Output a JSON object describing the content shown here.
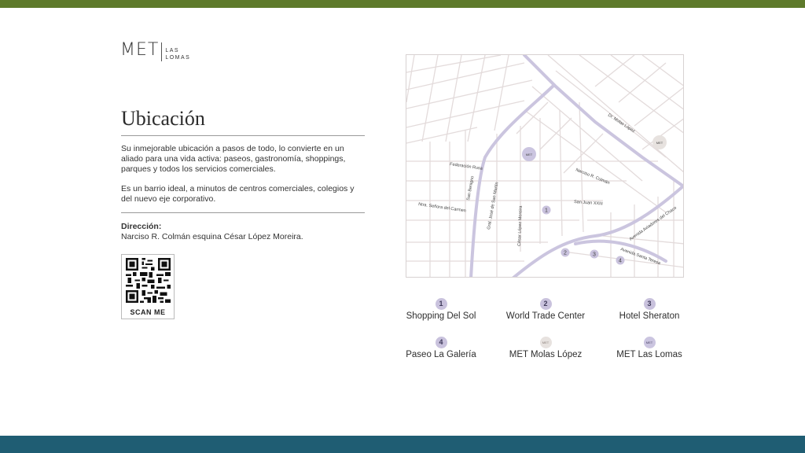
{
  "colors": {
    "top_bar": "#5e7a2b",
    "bottom_bar": "#1f5d73",
    "road": "#cbc5df",
    "street": "#e3dbdb",
    "marker": "#c9c2dd"
  },
  "logo": {
    "main": "MET",
    "sub_line1": "LAS",
    "sub_line2": "LOMAS"
  },
  "title": "Ubicación",
  "paragraph_1": "Su inmejorable ubicación a pasos de todo, lo convierte en un aliado para una vida activa: paseos, gastronomía, shoppings, parques y todos los servicios comerciales.",
  "paragraph_2": "Es un barrio ideal, a minutos de centros comerciales, colegios y del nuevo eje corporativo.",
  "address": {
    "label": "Dirección:",
    "value": "Narciso R. Colmán esquina César López Moreira."
  },
  "qr": {
    "label": "SCAN ME",
    "icon": "qr-code-icon"
  },
  "map": {
    "streets": {
      "dr_molas_lopez": "Dr. Molas López",
      "federacion_rusa": "Federación Rusa",
      "san_benigno": "San Benigno",
      "narciso_colman": "Narciso R. Colmán",
      "gral_san_martin": "Gral. José de San Martín",
      "san_juan_xxiii": "San Juan XXIII",
      "senora_carmen": "Ntra. Señora del Carmen",
      "cesar_lopez_moreira": "César López Moreira",
      "aviadores_chaco": "Avenida Aviadores del Chaco",
      "santa_teresa": "Avenida Santa Teresa"
    },
    "markers": {
      "m1": "1",
      "m2": "2",
      "m3": "3",
      "m4": "4",
      "met_text": "MET"
    }
  },
  "legend": [
    {
      "num": "1",
      "label": "Shopping Del Sol"
    },
    {
      "num": "2",
      "label": "World Trade Center"
    },
    {
      "num": "3",
      "label": "Hotel Sheraton"
    },
    {
      "num": "4",
      "label": "Paseo La Galería"
    },
    {
      "num": "MET",
      "label": "MET Molas López"
    },
    {
      "num": "MET",
      "label": "MET Las Lomas"
    }
  ]
}
